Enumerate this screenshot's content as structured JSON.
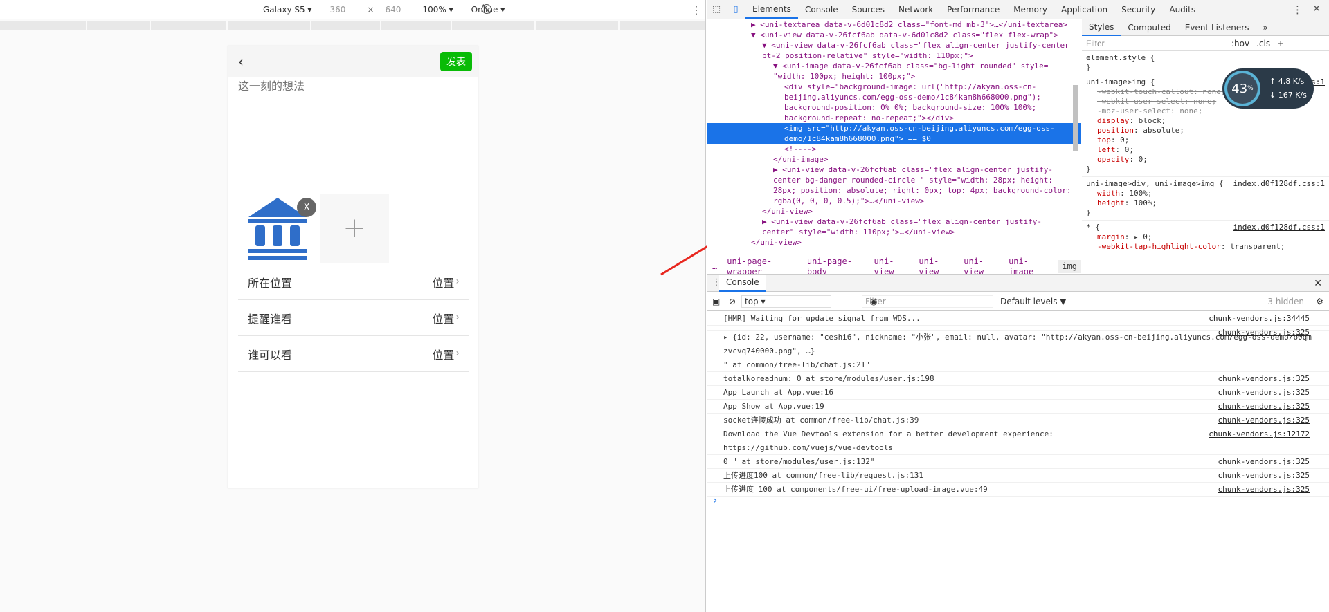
{
  "device_toolbar": {
    "device": "Galaxy S5",
    "width": "360",
    "times": "×",
    "height": "640",
    "zoom": "100%",
    "network": "Online"
  },
  "phone": {
    "back_glyph": "‹",
    "publish_label": "发表",
    "thought_placeholder": "这一刻的想法",
    "thumb_close": "X",
    "add_glyph": "+",
    "rows": [
      {
        "label": "所在位置",
        "value": "位置",
        "chev": "›"
      },
      {
        "label": "提醒谁看",
        "value": "位置",
        "chev": "›"
      },
      {
        "label": "谁可以看",
        "value": "位置",
        "chev": "›"
      }
    ]
  },
  "devtools": {
    "tabs": [
      "Elements",
      "Console",
      "Sources",
      "Network",
      "Performance",
      "Memory",
      "Application",
      "Security",
      "Audits"
    ],
    "more": "»",
    "elements": [
      {
        "i": 8,
        "t": "▶ <uni-textarea data-v-6d01c8d2 class=\"font-md mb-3\">…</uni-textarea>"
      },
      {
        "i": 8,
        "t": "▼ <uni-view data-v-26fcf6ab data-v-6d01c8d2 class=\"flex flex-wrap\">"
      },
      {
        "i": 10,
        "t": "▼ <uni-view data-v-26fcf6ab class=\"flex align-center justify-center"
      },
      {
        "i": 10,
        "t": "pt-2 position-relative\" style=\"width: 110px;\">"
      },
      {
        "i": 12,
        "t": "▼ <uni-image data-v-26fcf6ab class=\"bg-light rounded\" style="
      },
      {
        "i": 12,
        "t": "\"width: 100px; height: 100px;\">"
      },
      {
        "i": 14,
        "t": "<div style=\"background-image: url(\"http://akyan.oss-cn-"
      },
      {
        "i": 14,
        "t": "beijing.aliyuncs.com/egg-oss-demo/1c84kam8h668000.png\");"
      },
      {
        "i": 14,
        "t": "background-position: 0% 0%; background-size: 100% 100%;"
      },
      {
        "i": 14,
        "t": "background-repeat: no-repeat;\"></div>"
      },
      {
        "i": 14,
        "t": "<img src=\"http://akyan.oss-cn-beijing.aliyuncs.com/egg-oss-",
        "sel": true
      },
      {
        "i": 14,
        "t": "demo/1c84kam8h668000.png\"> == $0",
        "sel": true
      },
      {
        "i": 14,
        "t": "<!---->"
      },
      {
        "i": 12,
        "t": "</uni-image>"
      },
      {
        "i": 12,
        "t": "▶ <uni-view data-v-26fcf6ab class=\"flex align-center justify-"
      },
      {
        "i": 12,
        "t": "center bg-danger rounded-circle \" style=\"width: 28px; height:"
      },
      {
        "i": 12,
        "t": "28px; position: absolute; right: 0px; top: 4px; background-color:"
      },
      {
        "i": 12,
        "t": "rgba(0, 0, 0, 0.5);\">…</uni-view>"
      },
      {
        "i": 10,
        "t": "</uni-view>"
      },
      {
        "i": 10,
        "t": "▶ <uni-view data-v-26fcf6ab class=\"flex align-center justify-"
      },
      {
        "i": 10,
        "t": "center\" style=\"width: 110px;\">…</uni-view>"
      },
      {
        "i": 8,
        "t": "</uni-view>"
      }
    ],
    "breadcrumbs": [
      "…",
      "uni-page-wrapper",
      "uni-page-body",
      "uni-view",
      "uni-view",
      "uni-view",
      "uni-image",
      "img"
    ],
    "styles_tabs": [
      "Styles",
      "Computed",
      "Event Listeners"
    ],
    "styles_filter_placeholder": "Filter",
    "hov": ":hov",
    "cls": ".cls",
    "plus": "+",
    "rules": [
      {
        "sel": "element.style {",
        "src": "",
        "props": [],
        "end": "}"
      },
      {
        "sel": "uni-image>img {",
        "src": "index.d0f128df.css:1",
        "end": "}",
        "props": [
          {
            "n": "-webkit-touch-callout",
            "v": "none;",
            "strike": true
          },
          {
            "n": "-webkit-user-select",
            "v": "none;",
            "strike": true
          },
          {
            "n": "-moz-user-select",
            "v": "none;",
            "strike": true
          },
          {
            "n": "display",
            "v": "block;"
          },
          {
            "n": "position",
            "v": "absolute;"
          },
          {
            "n": "top",
            "v": "0;"
          },
          {
            "n": "left",
            "v": "0;"
          },
          {
            "n": "opacity",
            "v": "0;"
          }
        ]
      },
      {
        "sel": "uni-image>div, uni-image>img {",
        "src": "index.d0f128df.css:1",
        "end": "}",
        "props": [
          {
            "n": "width",
            "v": "100%;"
          },
          {
            "n": "height",
            "v": "100%;"
          }
        ]
      },
      {
        "sel": "* {",
        "src": "index.d0f128df.css:1",
        "end": "",
        "props": [
          {
            "n": "margin",
            "v": "▸ 0;"
          },
          {
            "n": "-webkit-tap-highlight-color",
            "v": "transparent;"
          }
        ]
      }
    ],
    "net_widget": {
      "percent": "43",
      "pct_sign": "%",
      "up": "4.8",
      "down": "167",
      "unit": "K/s"
    },
    "console": {
      "tab": "Console",
      "context": "top",
      "filter_placeholder": "Filter",
      "levels": "Default levels ▼",
      "hidden": "3 hidden",
      "lines": [
        {
          "text": "[HMR] Waiting for update signal from WDS...",
          "src": "chunk-vendors.js:34445"
        },
        {
          "text": "",
          "src": "chunk-vendors.js:325"
        },
        {
          "text": "▸ {id: 22, username: \"ceshi6\", nickname: \"小张\", email: null, avatar: \"http://akyan.oss-cn-beijing.aliyuncs.com/egg-oss-demo/b0qm",
          "src": ""
        },
        {
          "text": "zvcvq740000.png\", …}",
          "src": ""
        },
        {
          "text": "\" at common/free-lib/chat.js:21\"",
          "src": ""
        },
        {
          "text": "totalNoreadnum: 0  at store/modules/user.js:198",
          "src": "chunk-vendors.js:325"
        },
        {
          "text": "App Launch  at App.vue:16",
          "src": "chunk-vendors.js:325"
        },
        {
          "text": "App Show  at App.vue:19",
          "src": "chunk-vendors.js:325"
        },
        {
          "text": "socket连接成功  at common/free-lib/chat.js:39",
          "src": "chunk-vendors.js:325"
        },
        {
          "text": "Download the Vue Devtools extension for a better development experience:",
          "src": "chunk-vendors.js:12172"
        },
        {
          "text": "https://github.com/vuejs/vue-devtools",
          "src": ""
        },
        {
          "text": "0 \" at store/modules/user.js:132\"",
          "src": "chunk-vendors.js:325"
        },
        {
          "text": "上传进度100  at common/free-lib/request.js:131",
          "src": "chunk-vendors.js:325"
        },
        {
          "text": "上传进度 100  at components/free-ui/free-upload-image.vue:49",
          "src": "chunk-vendors.js:325"
        }
      ],
      "prompt": "›"
    }
  },
  "colors": {
    "publish": "#09bb07",
    "selected": "#1a73e8",
    "arrow": "#e8271f",
    "thumb": "#2f6ec9"
  }
}
